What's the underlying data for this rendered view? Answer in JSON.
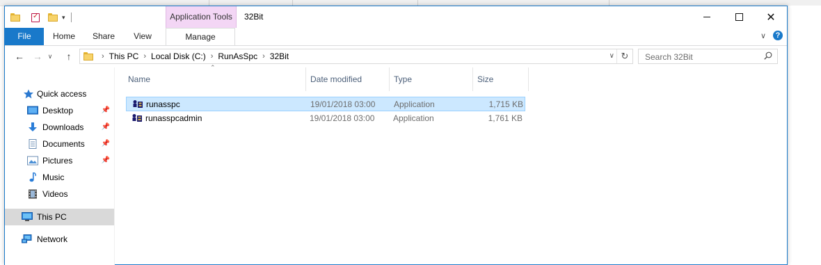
{
  "window": {
    "title": "32Bit",
    "context_group": "Application Tools"
  },
  "ribbon": {
    "tabs": [
      "File",
      "Home",
      "Share",
      "View",
      "Manage"
    ]
  },
  "address": {
    "crumbs": [
      "This PC",
      "Local Disk (C:)",
      "RunAsSpc",
      "32Bit"
    ]
  },
  "search": {
    "placeholder": "Search 32Bit"
  },
  "navpane": {
    "items": [
      {
        "label": "Quick access",
        "icon": "star-icon",
        "pinned": false
      },
      {
        "label": "Desktop",
        "icon": "desktop-icon",
        "pinned": true
      },
      {
        "label": "Downloads",
        "icon": "download-icon",
        "pinned": true
      },
      {
        "label": "Documents",
        "icon": "document-icon",
        "pinned": true
      },
      {
        "label": "Pictures",
        "icon": "pictures-icon",
        "pinned": true
      },
      {
        "label": "Music",
        "icon": "music-icon",
        "pinned": false
      },
      {
        "label": "Videos",
        "icon": "video-icon",
        "pinned": false
      },
      {
        "label": "This PC",
        "icon": "computer-icon",
        "pinned": false,
        "selected": true
      },
      {
        "label": "Network",
        "icon": "network-icon",
        "pinned": false
      }
    ]
  },
  "columns": {
    "name": "Name",
    "date": "Date modified",
    "type": "Type",
    "size": "Size"
  },
  "files": [
    {
      "name": "runasspc",
      "date": "19/01/2018 03:00",
      "type": "Application",
      "size": "1,715 KB",
      "selected": true
    },
    {
      "name": "runasspcadmin",
      "date": "19/01/2018 03:00",
      "type": "Application",
      "size": "1,761 KB",
      "selected": false
    }
  ],
  "colors": {
    "accent": "#1979ca",
    "context_tab": "#f3d6f5",
    "selection": "#cce8ff",
    "nav_selected": "#d9d9d9"
  }
}
